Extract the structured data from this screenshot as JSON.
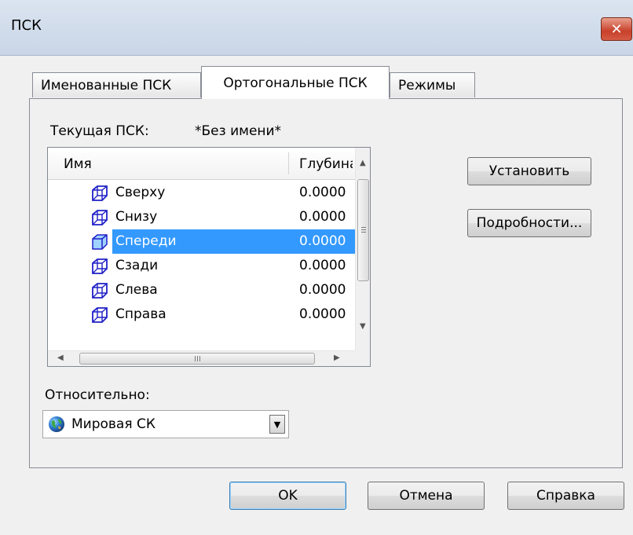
{
  "window": {
    "title": "ПСК",
    "close_label": "✕"
  },
  "tabs": [
    {
      "label": "Именованные ПСК"
    },
    {
      "label": "Ортогональные ПСК"
    },
    {
      "label": "Режимы"
    }
  ],
  "current_ucs": {
    "label": "Текущая ПСК:",
    "value": "*Без имени*"
  },
  "list": {
    "columns": [
      "Имя",
      "Глубина"
    ],
    "rows": [
      {
        "name": "Сверху",
        "depth": "0.0000",
        "icon": "cube-icon"
      },
      {
        "name": "Снизу",
        "depth": "0.0000",
        "icon": "cube-icon"
      },
      {
        "name": "Спереди",
        "depth": "0.0000",
        "icon": "cube-front-icon",
        "selected": true
      },
      {
        "name": "Сзади",
        "depth": "0.0000",
        "icon": "cube-icon"
      },
      {
        "name": "Слева",
        "depth": "0.0000",
        "icon": "cube-icon"
      },
      {
        "name": "Справа",
        "depth": "0.0000",
        "icon": "cube-icon"
      }
    ]
  },
  "side_buttons": {
    "set": "Установить",
    "details": "Подробности..."
  },
  "relative": {
    "label": "Относительно:",
    "value": "Мировая СК",
    "icon": "globe-icon"
  },
  "footer": {
    "ok": "OK",
    "cancel": "Отмена",
    "help": "Справка"
  },
  "colors": {
    "selection": "#3399ff",
    "cube_icon": "#2020c8",
    "close_button": "#c8402a"
  }
}
